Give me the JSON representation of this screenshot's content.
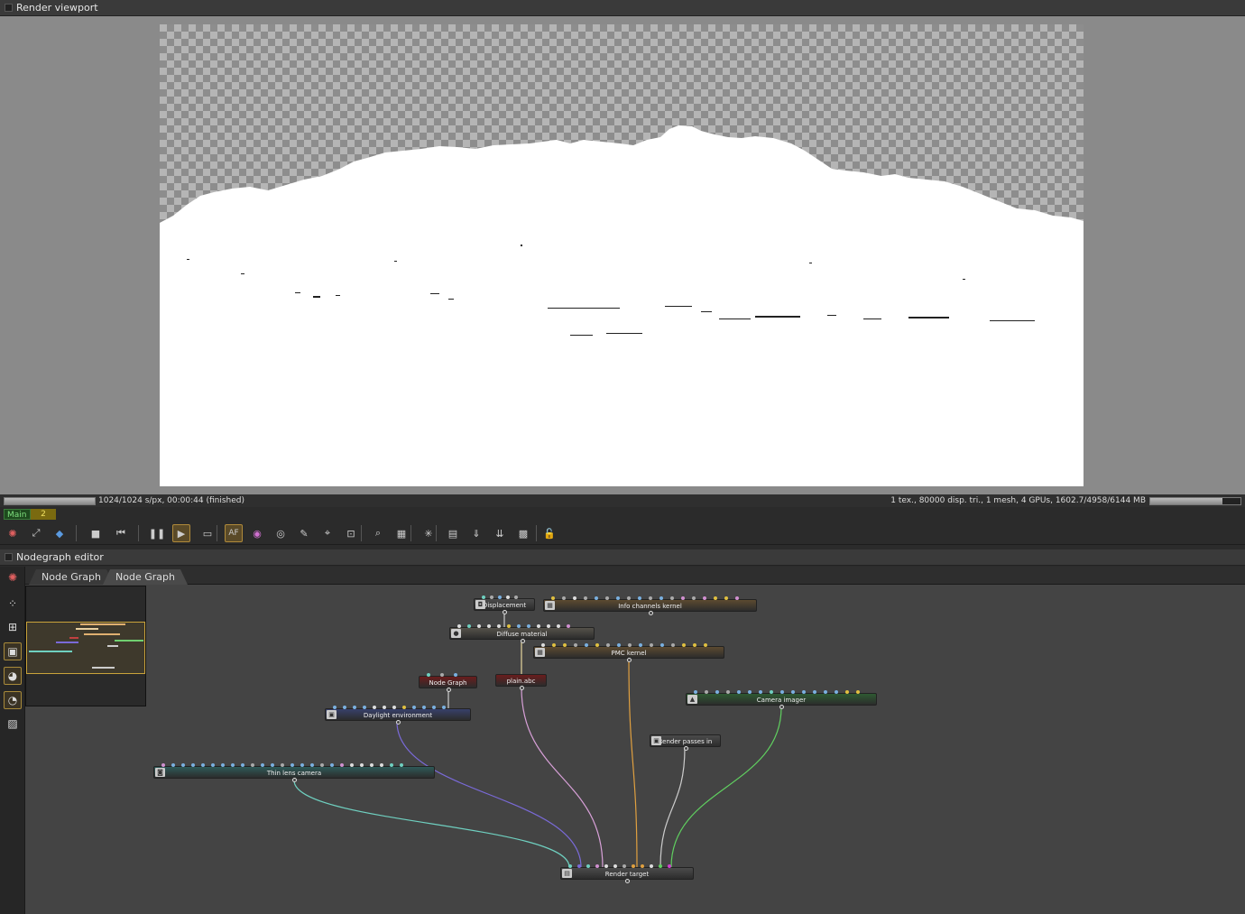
{
  "viewport": {
    "title": "Render viewport"
  },
  "status": {
    "left_text": "1024/1024 s/px, 00:00:44 (finished)",
    "right_text": "1 tex., 80000 disp. tri., 1 mesh, 4 GPUs, 1602.7/4958/6144 MB",
    "progress": 1.0,
    "memory_fraction": 0.8
  },
  "tags": {
    "main": "Main",
    "second": "2"
  },
  "toolbar": {
    "buttons": [
      {
        "name": "octane-logo-icon",
        "glyph": "✺"
      },
      {
        "name": "fit-view-icon",
        "glyph": "⤢"
      },
      {
        "name": "cube-icon",
        "glyph": "◆"
      },
      {
        "name": "stop-icon",
        "glyph": "■"
      },
      {
        "name": "restart-icon",
        "glyph": "⏮"
      },
      {
        "name": "pause-icon",
        "glyph": "❚❚"
      },
      {
        "name": "start-icon",
        "glyph": "▶"
      },
      {
        "name": "display-icon",
        "glyph": "▭"
      },
      {
        "name": "af-icon",
        "glyph": "AF"
      },
      {
        "name": "color-picker-icon",
        "glyph": "◉"
      },
      {
        "name": "focus-picker-icon",
        "glyph": "◎"
      },
      {
        "name": "white-balance-icon",
        "glyph": "✎"
      },
      {
        "name": "material-picker-icon",
        "glyph": "⌖"
      },
      {
        "name": "object-picker-icon",
        "glyph": "⊡"
      },
      {
        "name": "zoom-icon",
        "glyph": "⌕"
      },
      {
        "name": "region-icon",
        "glyph": "▦"
      },
      {
        "name": "settings-icon",
        "glyph": "✳"
      },
      {
        "name": "clipboard-icon",
        "glyph": "▤"
      },
      {
        "name": "save-render-icon",
        "glyph": "⇓"
      },
      {
        "name": "export-passes-icon",
        "glyph": "⇊"
      },
      {
        "name": "background-icon",
        "glyph": "▩"
      },
      {
        "name": "lock-icon",
        "glyph": "🔓"
      }
    ]
  },
  "nodegraph": {
    "title": "Nodegraph editor",
    "tabs": [
      "Node Graph",
      "Node Graph"
    ],
    "side_buttons": [
      "octane-icon",
      "grid-nodes-icon",
      "tree-icon",
      "add-node-icon",
      "material-icon",
      "texture-icon",
      "clear-icon"
    ],
    "nodes": [
      {
        "id": "displacement",
        "label": "Displacement",
        "color": "#4b4b4b"
      },
      {
        "id": "info",
        "label": "Info channels kernel",
        "color": "#5c4a30"
      },
      {
        "id": "diffuse",
        "label": "Diffuse material",
        "color": "#55524a"
      },
      {
        "id": "pmc",
        "label": "PMC kernel",
        "color": "#5c4a30"
      },
      {
        "id": "nodegraph",
        "label": "Node Graph",
        "color": "#6a1c1c"
      },
      {
        "id": "plain",
        "label": "plain.abc",
        "color": "#6a1c1c"
      },
      {
        "id": "daylight",
        "label": "Daylight environment",
        "color": "#38406a"
      },
      {
        "id": "cameraimager",
        "label": "Camera imager",
        "color": "#2e5a32"
      },
      {
        "id": "passes",
        "label": "Render passes in",
        "color": "#4b4b4b"
      },
      {
        "id": "thinlens",
        "label": "Thin lens camera",
        "color": "#2e5a58"
      },
      {
        "id": "target",
        "label": "Render target",
        "color": "#4b4b4b"
      }
    ]
  },
  "colors": {
    "accent": "#b08a3a",
    "wire_camera": "#6fd0c0",
    "wire_env": "#7a6ad8",
    "wire_geo": "#d8a0d8",
    "wire_kernel": "#e0a040",
    "wire_passes": "#cccccc",
    "wire_imager": "#60d060"
  }
}
